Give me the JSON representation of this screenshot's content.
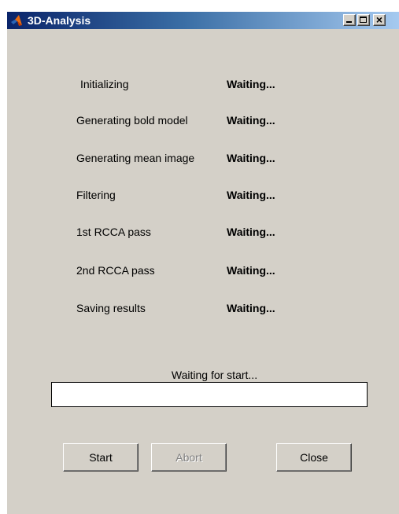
{
  "window": {
    "title": "3D-Analysis"
  },
  "steps": [
    {
      "label": "Initializing",
      "status": "Waiting..."
    },
    {
      "label": "Generating bold model",
      "status": "Waiting..."
    },
    {
      "label": "Generating mean image",
      "status": "Waiting..."
    },
    {
      "label": "Filtering",
      "status": "Waiting..."
    },
    {
      "label": "1st RCCA pass",
      "status": "Waiting..."
    },
    {
      "label": "2nd RCCA pass",
      "status": "Waiting..."
    },
    {
      "label": "Saving results",
      "status": "Waiting..."
    }
  ],
  "status_message": "Waiting for start...",
  "progress": 0,
  "buttons": {
    "start": "Start",
    "abort": "Abort",
    "close": "Close"
  },
  "colors": {
    "window_background": "#d4d0c8",
    "titlebar_start": "#0a246a",
    "titlebar_end": "#a6caf0",
    "progress_background": "#ffffff"
  }
}
